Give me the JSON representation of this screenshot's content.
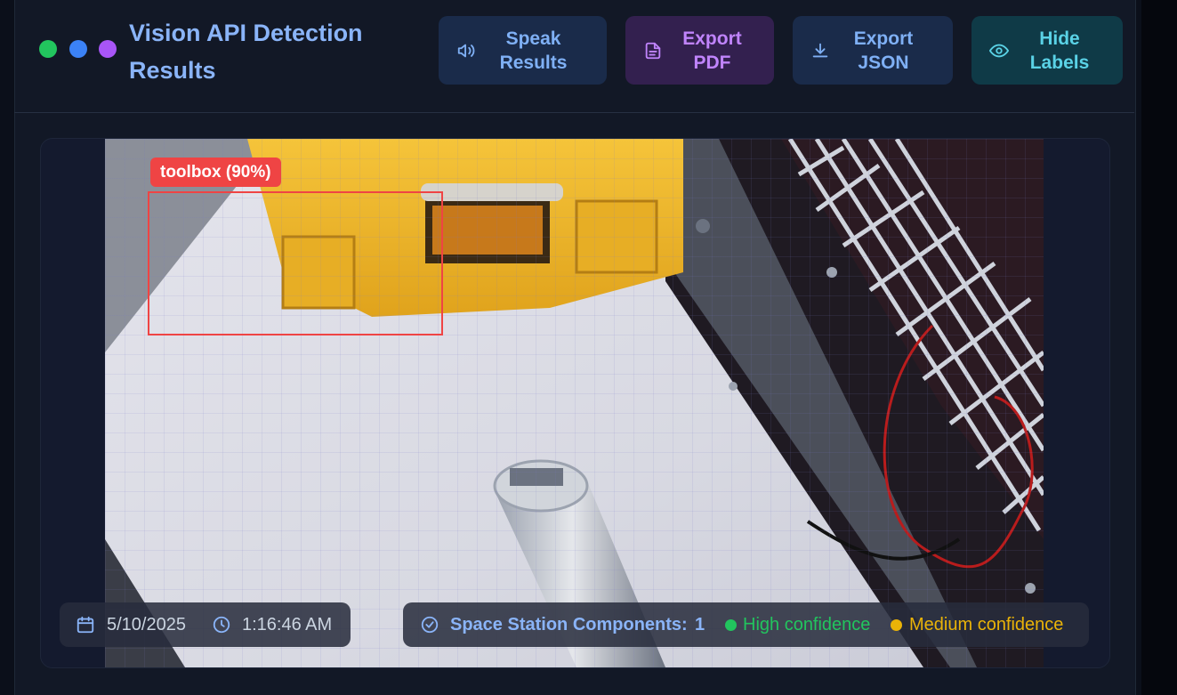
{
  "header": {
    "title": "Vision API Detection Results",
    "window_dots": [
      "#22c55e",
      "#3b82f6",
      "#a855f7"
    ],
    "buttons": {
      "speak": "Speak\nResults",
      "pdf": "Export\nPDF",
      "json": "Export\nJSON",
      "hide": "Hide\nLabels"
    }
  },
  "detection": {
    "label": "toolbox (90%)",
    "color": "#ef4444"
  },
  "footer": {
    "date": "5/10/2025",
    "time": "1:16:46 AM",
    "category_label": "Space Station Components:",
    "category_count": "1",
    "legend": [
      {
        "label": "High confidence",
        "color": "#22c55e"
      },
      {
        "label": "Medium confidence",
        "color": "#eab308"
      }
    ]
  },
  "icons": {
    "speak": "speaker-icon",
    "pdf": "document-icon",
    "json": "download-icon",
    "hide": "eye-icon",
    "date": "calendar-icon",
    "time": "clock-icon",
    "category": "check-circle-icon"
  }
}
